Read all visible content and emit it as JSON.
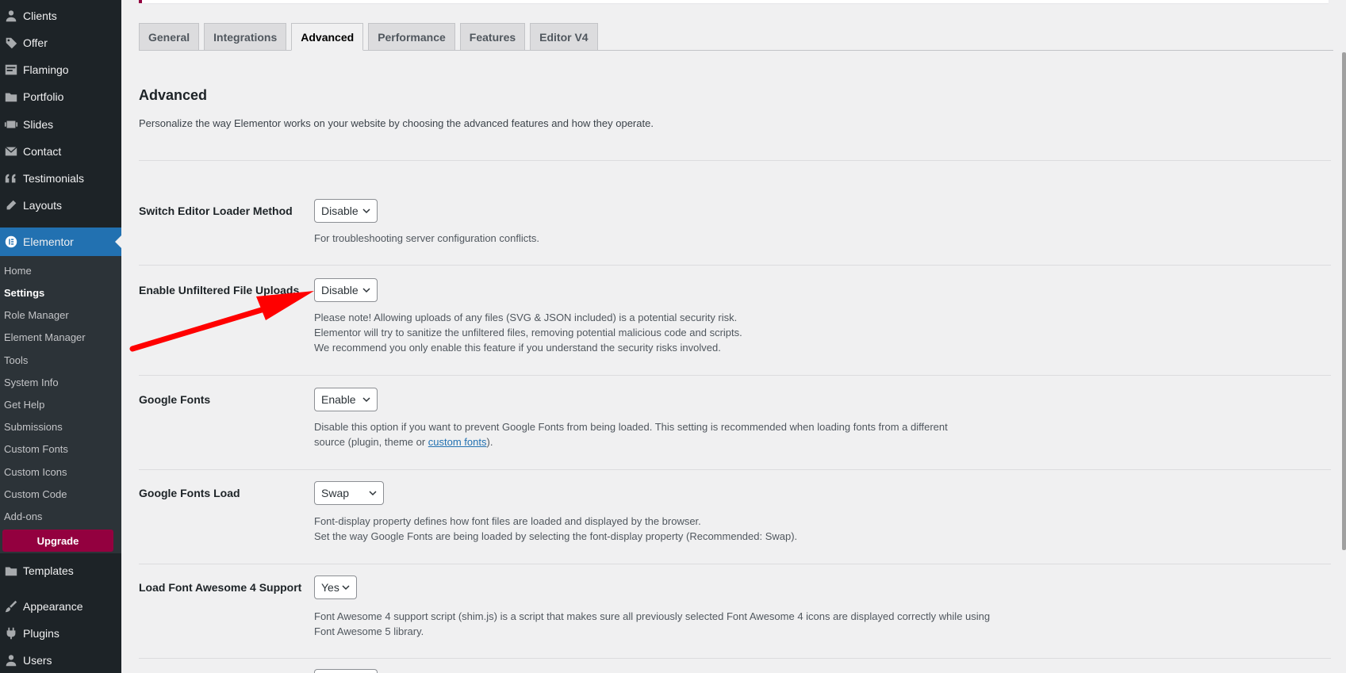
{
  "sidebar": {
    "menu": [
      {
        "label": "Clients",
        "icon": "users-icon"
      },
      {
        "label": "Offer",
        "icon": "tag-icon"
      },
      {
        "label": "Flamingo",
        "icon": "feedback-icon"
      },
      {
        "label": "Portfolio",
        "icon": "folder-icon"
      },
      {
        "label": "Slides",
        "icon": "slides-icon"
      },
      {
        "label": "Contact",
        "icon": "envelope-icon"
      },
      {
        "label": "Testimonials",
        "icon": "quote-icon"
      },
      {
        "label": "Layouts",
        "icon": "edit-icon"
      },
      {
        "label": "Elementor",
        "icon": "elementor-icon"
      }
    ],
    "submenu": [
      "Home",
      "Settings",
      "Role Manager",
      "Element Manager",
      "Tools",
      "System Info",
      "Get Help",
      "Submissions",
      "Custom Fonts",
      "Custom Icons",
      "Custom Code",
      "Add-ons"
    ],
    "current_submenu": "Settings",
    "upgrade_label": "Upgrade",
    "menu_bottom": [
      {
        "label": "Templates",
        "icon": "folder-icon"
      },
      {
        "label": "Appearance",
        "icon": "paintbrush-icon"
      },
      {
        "label": "Plugins",
        "icon": "plugin-icon"
      },
      {
        "label": "Users",
        "icon": "users-icon"
      }
    ]
  },
  "tabs": [
    "General",
    "Integrations",
    "Advanced",
    "Performance",
    "Features",
    "Editor V4"
  ],
  "active_tab": "Advanced",
  "section": {
    "title": "Advanced",
    "description": "Personalize the way Elementor works on your website by choosing the advanced features and how they operate."
  },
  "settings": [
    {
      "label": "Switch Editor Loader Method",
      "value": "Disable",
      "desc": [
        "For troubleshooting server configuration conflicts."
      ]
    },
    {
      "label": "Enable Unfiltered File Uploads",
      "value": "Disable",
      "desc": [
        "Please note! Allowing uploads of any files (SVG & JSON included) is a potential security risk.",
        "Elementor will try to sanitize the unfiltered files, removing potential malicious code and scripts.",
        "We recommend you only enable this feature if you understand the security risks involved."
      ]
    },
    {
      "label": "Google Fonts",
      "value": "Enable",
      "desc_a": "Disable this option if you want to prevent Google Fonts from being loaded. This setting is recommended when loading fonts from a different",
      "desc_b": "source (plugin, theme or ",
      "desc_link": "custom fonts",
      "desc_c": ")."
    },
    {
      "label": "Google Fonts Load",
      "value": "Swap",
      "desc": [
        "Font-display property defines how font files are loaded and displayed by the browser.",
        "Set the way Google Fonts are being loaded by selecting the font-display property (Recommended: Swap)."
      ]
    },
    {
      "label": "Load Font Awesome 4 Support",
      "value": "Yes",
      "desc": [
        "Font Awesome 4 support script (shim.js) is a script that makes sure all previously selected Font Awesome 4 icons are displayed correctly while using",
        "Font Awesome 5 library."
      ]
    }
  ],
  "colors": {
    "sidebar": "#1d2327",
    "accent": "#2271b1",
    "upgrade": "#93003f",
    "arrow": "#ff0000"
  }
}
